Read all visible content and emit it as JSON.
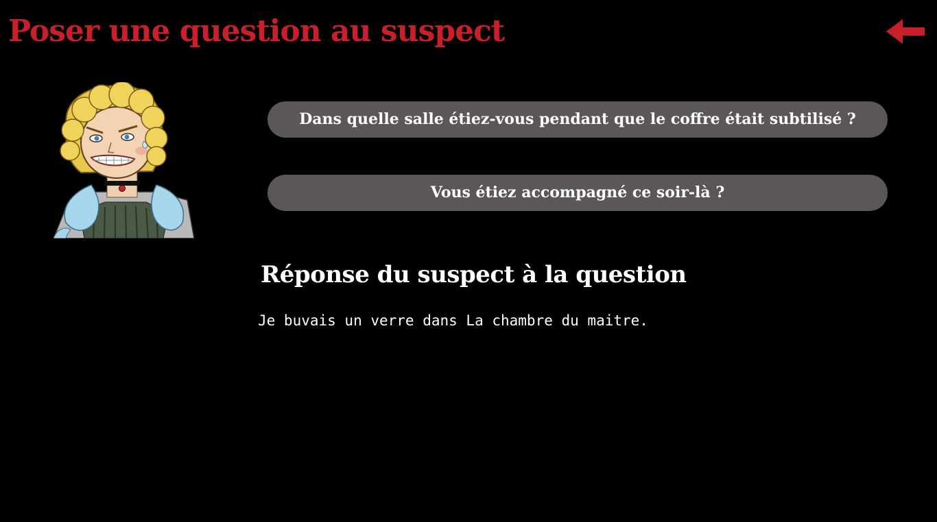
{
  "header": {
    "title": "Poser une question au suspect",
    "back_icon": "arrow-left-icon",
    "accent_color": "#c8202a"
  },
  "suspect": {
    "portrait_icon": "suspect-portrait"
  },
  "questions": [
    {
      "label": "Dans quelle salle étiez-vous pendant que le coffre était subtilisé ?"
    },
    {
      "label": "Vous étiez accompagné ce soir-là ?"
    }
  ],
  "answer": {
    "heading": "Réponse du suspect à la question",
    "text": "Je buvais un verre dans La chambre du maitre."
  },
  "colors": {
    "background": "#000000",
    "button_bg": "#5b5756",
    "text": "#ffffff"
  }
}
